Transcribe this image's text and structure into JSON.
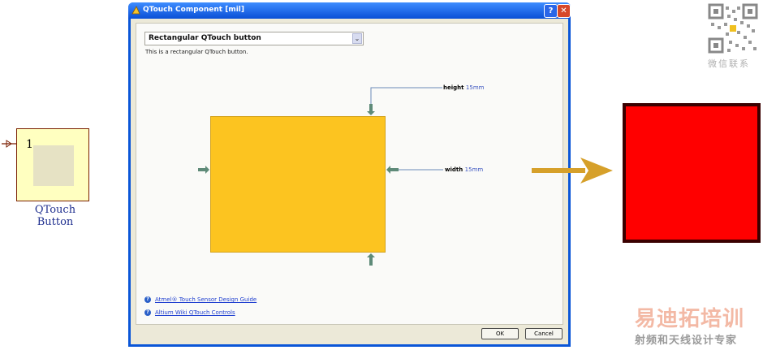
{
  "symbol": {
    "pin_number": "1",
    "label": "QTouch Button"
  },
  "dialog": {
    "title": "QTouch Component [mil]",
    "help_button": "?",
    "close_button": "✕",
    "dropdown": {
      "selected": "Rectangular QTouch button",
      "arrow": "⌄"
    },
    "description": "This is a rectangular QTouch button.",
    "dimensions": {
      "height_label": "height",
      "height_value": "15mm",
      "width_label": "width",
      "width_value": "15mm"
    },
    "links": [
      {
        "text": "Atmel® Touch Sensor Design Guide",
        "icon": "help-circle-icon"
      },
      {
        "text": "Altium Wiki QTouch Controls",
        "icon": "help-circle-icon"
      }
    ],
    "ok_label": "OK",
    "cancel_label": "Cancel"
  },
  "watermark": {
    "wechat_label": "微信联系",
    "brand_title": "易迪拓培训",
    "brand_subtitle": "射频和天线设计专家"
  },
  "colors": {
    "button_fill": "#fcc420",
    "result_fill": "#ff0000",
    "arrow": "#d6a02a"
  }
}
